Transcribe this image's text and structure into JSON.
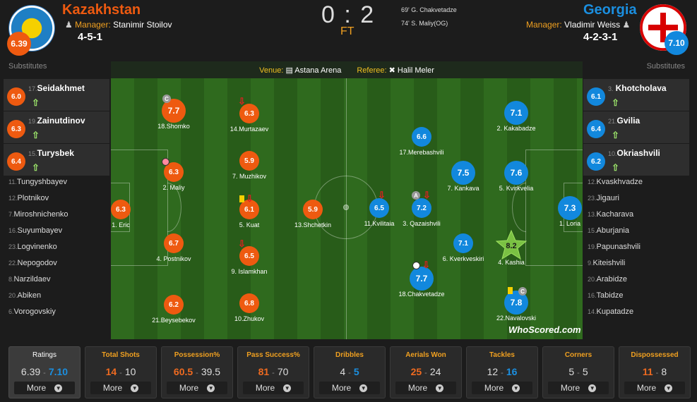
{
  "home": {
    "name": "Kazakhstan",
    "manager_label": "Manager:",
    "manager": "Stanimir Stoilov",
    "formation": "4-5-1",
    "rating": "6.39",
    "color": "#ee5a10"
  },
  "away": {
    "name": "Georgia",
    "manager_label": "Manager:",
    "manager": "Vladimir Weiss",
    "formation": "4-2-3-1",
    "rating": "7.10",
    "color": "#1288dd"
  },
  "score": "0 : 2",
  "status": "FT",
  "events": [
    "69' G. Chakvetadze",
    "74' S. Maliy(OG)"
  ],
  "venue": {
    "label": "Venue:",
    "value": "Astana Arena"
  },
  "referee": {
    "label": "Referee:",
    "value": "Halil Meler"
  },
  "substitutes_label": "Substitutes",
  "home_subs_played": [
    {
      "num": "17.",
      "name": "Seidakhmet",
      "rating": "6.0"
    },
    {
      "num": "19.",
      "name": "Zainutdinov",
      "rating": "6.3"
    },
    {
      "num": "15.",
      "name": "Turysbek",
      "rating": "6.4"
    }
  ],
  "home_bench": [
    {
      "num": "11.",
      "name": "Tungyshbayev"
    },
    {
      "num": "12.",
      "name": "Plotnikov"
    },
    {
      "num": "7.",
      "name": "Miroshnichenko"
    },
    {
      "num": "16.",
      "name": "Suyumbayev"
    },
    {
      "num": "23.",
      "name": "Logvinenko"
    },
    {
      "num": "22.",
      "name": "Nepogodov"
    },
    {
      "num": "8.",
      "name": "Narzildaev"
    },
    {
      "num": "20.",
      "name": "Abiken"
    },
    {
      "num": "6.",
      "name": "Vorogovskiy"
    }
  ],
  "away_subs_played": [
    {
      "num": "3.",
      "name": "Khotcholava",
      "rating": "6.1"
    },
    {
      "num": "21.",
      "name": "Gvilia",
      "rating": "6.4"
    },
    {
      "num": "10.",
      "name": "Okriashvili",
      "rating": "6.2"
    }
  ],
  "away_bench": [
    {
      "num": "12.",
      "name": "Kvaskhvadze"
    },
    {
      "num": "23.",
      "name": "Jigauri"
    },
    {
      "num": "13.",
      "name": "Kacharava"
    },
    {
      "num": "15.",
      "name": "Aburjania"
    },
    {
      "num": "19.",
      "name": "Papunashvili"
    },
    {
      "num": "9.",
      "name": "Kiteishvili"
    },
    {
      "num": "20.",
      "name": "Arabidze"
    },
    {
      "num": "16.",
      "name": "Tabidze"
    },
    {
      "num": "14.",
      "name": "Kupatadze"
    }
  ],
  "home_players": [
    {
      "label": "18.Shomko",
      "rating": "7.7"
    },
    {
      "label": "14.Murtazaev",
      "rating": "6.3"
    },
    {
      "label": "2. Maliy",
      "rating": "6.3"
    },
    {
      "label": "7. Muzhikov",
      "rating": "5.9"
    },
    {
      "label": "1. Eric",
      "rating": "6.3"
    },
    {
      "label": "5. Kuat",
      "rating": "6.1"
    },
    {
      "label": "13.Shchetkin",
      "rating": "5.9"
    },
    {
      "label": "4. Postnikov",
      "rating": "6.7"
    },
    {
      "label": "9. Islamkhan",
      "rating": "6.5"
    },
    {
      "label": "21.Beysebekov",
      "rating": "6.2"
    },
    {
      "label": "10.Zhukov",
      "rating": "6.8"
    }
  ],
  "away_players": [
    {
      "label": "2. Kakabadze",
      "rating": "7.1"
    },
    {
      "label": "17.Merebashvili",
      "rating": "6.6"
    },
    {
      "label": "7. Kankava",
      "rating": "7.5"
    },
    {
      "label": "5. Kvirkvelia",
      "rating": "7.6"
    },
    {
      "label": "11.Kvilitaia",
      "rating": "6.5"
    },
    {
      "label": "3. Qazaishvili",
      "rating": "7.2"
    },
    {
      "label": "1. Loria",
      "rating": "7.3"
    },
    {
      "label": "6. Kverkveskiri",
      "rating": "7.1"
    },
    {
      "label": "4. Kashia",
      "rating": "8.2"
    },
    {
      "label": "18.Chakvetadze",
      "rating": "7.7"
    },
    {
      "label": "22.Navalovski",
      "rating": "7.8"
    }
  ],
  "brand": "WhoScored.com",
  "stats": [
    {
      "title": "Ratings",
      "home": "6.39",
      "away": "7.10",
      "winner": "away"
    },
    {
      "title": "Total Shots",
      "home": "14",
      "away": "10",
      "winner": "home"
    },
    {
      "title": "Possession%",
      "home": "60.5",
      "away": "39.5",
      "winner": "home"
    },
    {
      "title": "Pass Success%",
      "home": "81",
      "away": "70",
      "winner": "home"
    },
    {
      "title": "Dribbles",
      "home": "4",
      "away": "5",
      "winner": "away"
    },
    {
      "title": "Aerials Won",
      "home": "25",
      "away": "24",
      "winner": "home"
    },
    {
      "title": "Tackles",
      "home": "12",
      "away": "16",
      "winner": "away"
    },
    {
      "title": "Corners",
      "home": "5",
      "away": "5",
      "winner": "none"
    },
    {
      "title": "Dispossessed",
      "home": "11",
      "away": "8",
      "winner": "home"
    }
  ],
  "more_label": "More"
}
